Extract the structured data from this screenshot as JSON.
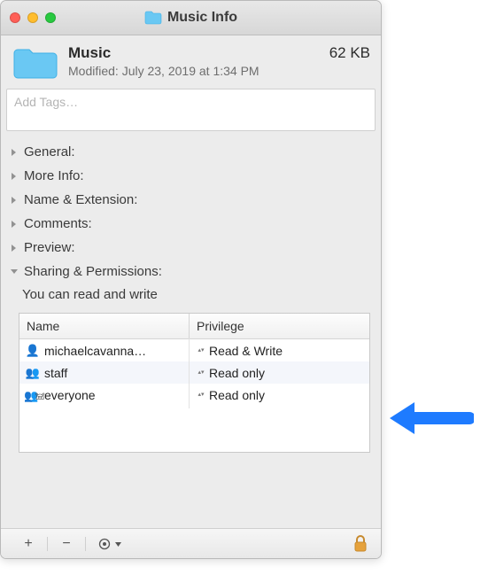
{
  "window": {
    "title": "Music Info"
  },
  "header": {
    "name": "Music",
    "size": "62 KB",
    "modified_label": "Modified:",
    "modified_value": "July 23, 2019 at 1:34 PM"
  },
  "tags": {
    "placeholder": "Add Tags…"
  },
  "sections": [
    {
      "label": "General:",
      "expanded": false
    },
    {
      "label": "More Info:",
      "expanded": false
    },
    {
      "label": "Name & Extension:",
      "expanded": false
    },
    {
      "label": "Comments:",
      "expanded": false
    },
    {
      "label": "Preview:",
      "expanded": false
    },
    {
      "label": "Sharing & Permissions:",
      "expanded": true
    }
  ],
  "permissions": {
    "note": "You can read and write",
    "columns": {
      "name": "Name",
      "privilege": "Privilege"
    },
    "rows": [
      {
        "icon": "person",
        "name": "michaelcavanna…",
        "privilege": "Read & Write"
      },
      {
        "icon": "people",
        "name": "staff",
        "privilege": "Read only"
      },
      {
        "icon": "people3",
        "name": "everyone",
        "privilege": "Read only"
      }
    ]
  },
  "footer": {
    "add": "+",
    "remove": "−",
    "actions_icon": "⊙",
    "lock_icon": "🔒"
  },
  "colors": {
    "accent_blue": "#1e7bff",
    "folder_blue": "#68c6f2"
  }
}
